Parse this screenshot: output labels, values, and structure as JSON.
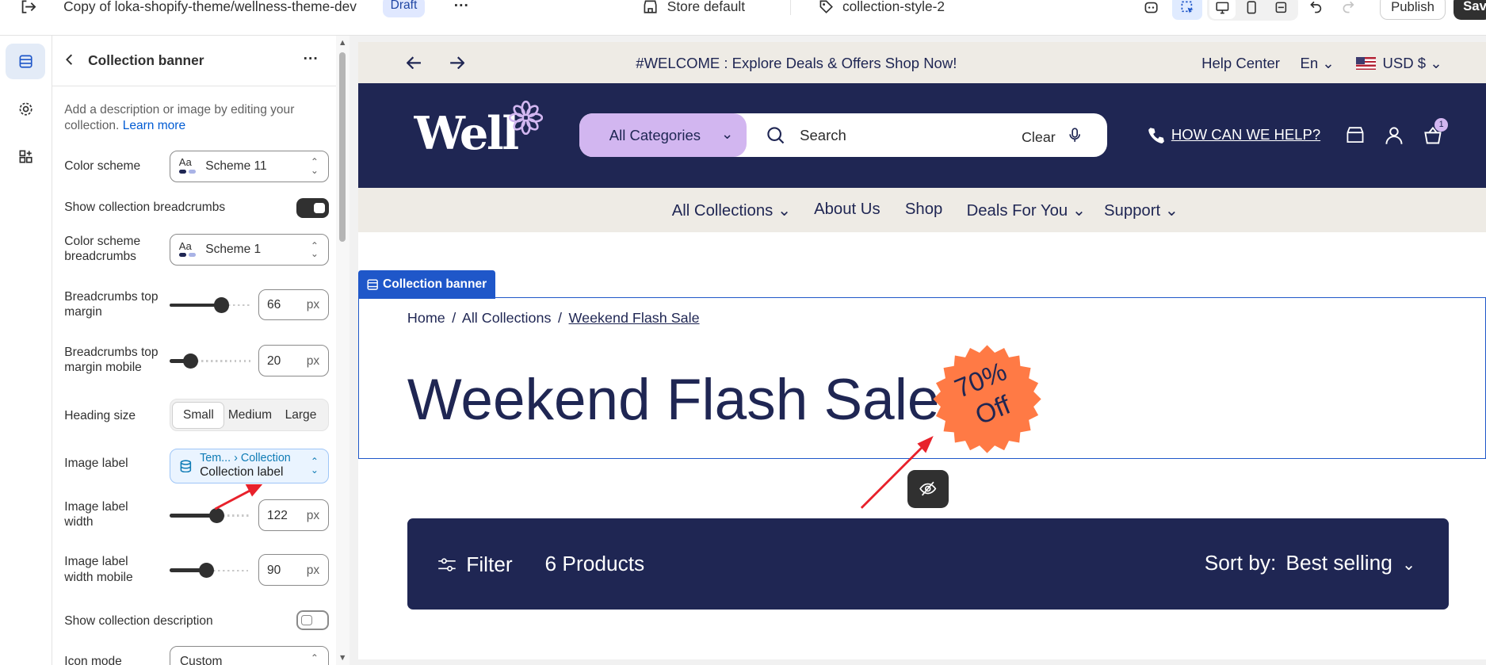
{
  "topbar": {
    "theme_name": "Copy of loka-shopify-theme/wellness-theme-dev",
    "status_badge": "Draft",
    "store": "Store default",
    "template": "collection-style-2",
    "publish_label": "Publish",
    "save_label": "Sav"
  },
  "panel": {
    "title": "Collection banner",
    "description": "Add a description or image by editing your collection.",
    "learn_more": "Learn more",
    "color_scheme_label": "Color scheme",
    "color_scheme_value": "Scheme 11",
    "show_breadcrumbs_label": "Show collection breadcrumbs",
    "show_breadcrumbs_on": true,
    "breadcrumbs_scheme_label": "Color scheme breadcrumbs",
    "breadcrumbs_scheme_value": "Scheme 1",
    "bc_top_margin_label": "Breadcrumbs top margin",
    "bc_top_margin_value": "66",
    "bc_top_margin_mobile_label": "Breadcrumbs top margin mobile",
    "bc_top_margin_mobile_value": "20",
    "unit": "px",
    "heading_size_label": "Heading size",
    "heading_size_options": [
      "Small",
      "Medium",
      "Large"
    ],
    "heading_size_selected": "Small",
    "image_label_label": "Image label",
    "image_label_source": "Tem...",
    "image_label_source_sep": "›",
    "image_label_source_detail": "Collection",
    "image_label_value": "Collection label",
    "image_label_width_label": "Image label width",
    "image_label_width_value": "122",
    "image_label_width_mobile_label": "Image label width mobile",
    "image_label_width_mobile_value": "90",
    "show_description_label": "Show collection description",
    "show_description_on": false,
    "icon_mode_label": "Icon mode",
    "icon_mode_value": "Custom"
  },
  "store": {
    "announcement": "#WELCOME : Explore Deals & Offers Shop Now!",
    "help_center": "Help Center",
    "language": "En",
    "currency": "USD $",
    "logo_text": "Well",
    "categories_label": "All Categories",
    "search_placeholder": "Search",
    "clear_label": "Clear",
    "help_link": "HOW CAN WE HELP?",
    "cart_count": "1",
    "nav": [
      "All Collections",
      "About Us",
      "Shop",
      "Deals For You",
      "Support"
    ],
    "section_tag": "Collection banner",
    "breadcrumb": [
      "Home",
      "All Collections",
      "Weekend Flash Sale"
    ],
    "breadcrumb_sep": "/",
    "heading": "Weekend Flash Sale",
    "sticker_line1": "70%",
    "sticker_line2": "Off",
    "filter_label": "Filter",
    "product_count": "6 Products",
    "sort_label": "Sort by:",
    "sort_value": "Best selling"
  },
  "colors": {
    "navy": "#1f2653",
    "accent_blue": "#1f57c9",
    "sticker": "#ff7a45",
    "categories_bg": "#d2b6f0",
    "annotation_arrow": "#e8212b"
  }
}
